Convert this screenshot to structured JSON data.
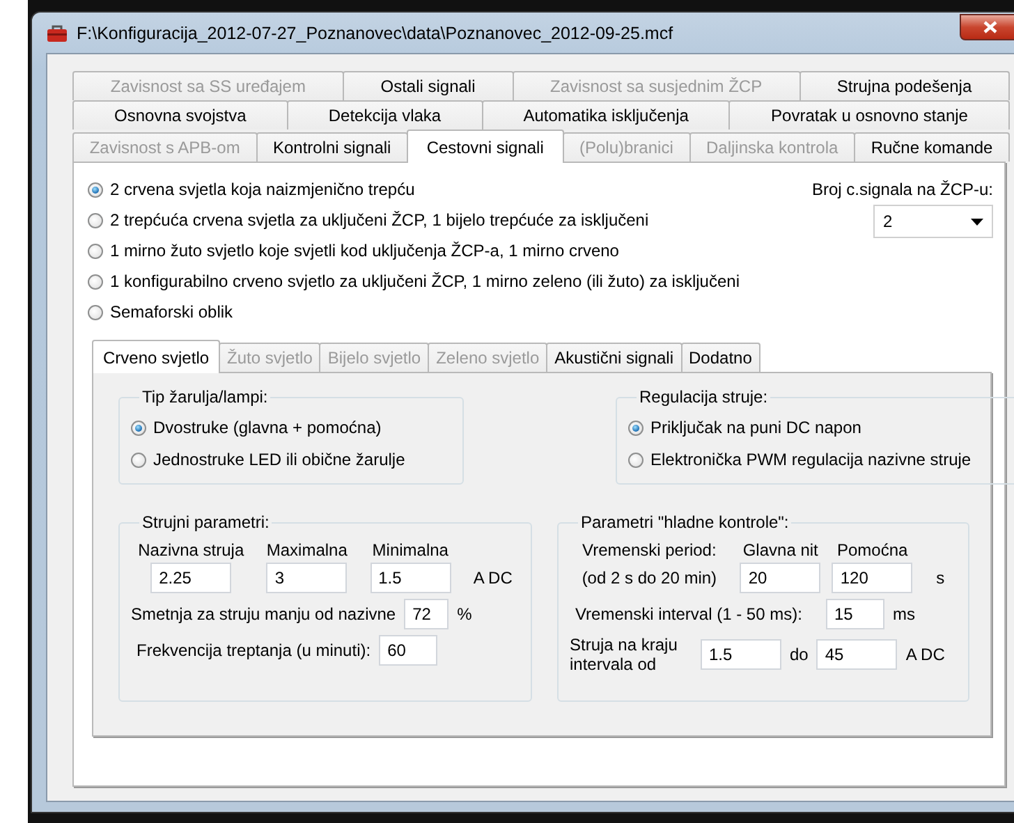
{
  "window": {
    "title": "F:\\Konfiguracija_2012-07-27_Poznanovec\\data\\Poznanovec_2012-09-25.mcf"
  },
  "tab_rows": [
    {
      "tabs": [
        {
          "label": "Zavisnost sa SS uređajem",
          "selected": false,
          "disabled": true
        },
        {
          "label": "Ostali signali",
          "selected": false,
          "disabled": false
        },
        {
          "label": "Zavisnost sa susjednim ŽCP",
          "selected": false,
          "disabled": true
        },
        {
          "label": "Strujna podešenja",
          "selected": false,
          "disabled": false
        }
      ]
    },
    {
      "tabs": [
        {
          "label": "Osnovna svojstva",
          "selected": false,
          "disabled": false
        },
        {
          "label": "Detekcija vlaka",
          "selected": false,
          "disabled": false
        },
        {
          "label": "Automatika isključenja",
          "selected": false,
          "disabled": false
        },
        {
          "label": "Povratak u osnovno stanje",
          "selected": false,
          "disabled": false
        }
      ]
    },
    {
      "tabs": [
        {
          "label": "Zavisnost s APB-om",
          "selected": false,
          "disabled": true
        },
        {
          "label": "Kontrolni signali",
          "selected": false,
          "disabled": false
        },
        {
          "label": "Cestovni signali",
          "selected": true,
          "disabled": false
        },
        {
          "label": "(Polu)branici",
          "selected": false,
          "disabled": true
        },
        {
          "label": "Daljinska kontrola",
          "selected": false,
          "disabled": true
        },
        {
          "label": "Ručne komande",
          "selected": false,
          "disabled": false
        }
      ]
    }
  ],
  "signal_modes": [
    {
      "label": "2 crvena svjetla koja naizmjenično trepću",
      "selected": true
    },
    {
      "label": "2 trepćuća crvena svjetla za uključeni ŽCP, 1 bijelo trepćuće za isključeni",
      "selected": false
    },
    {
      "label": "1 mirno žuto svjetlo koje svjetli kod uključenja ŽCP-a, 1 mirno crveno",
      "selected": false
    },
    {
      "label": "1 konfigurabilno crveno svjetlo za uključeni ŽCP, 1 mirno zeleno (ili žuto) za isključeni",
      "selected": false
    },
    {
      "label": "Semaforski oblik",
      "selected": false
    }
  ],
  "signal_count": {
    "label": "Broj c.signala na ŽCP-u:",
    "value": "2"
  },
  "light_tabs": [
    {
      "label": "Crveno svjetlo",
      "selected": true,
      "disabled": false
    },
    {
      "label": "Žuto svjetlo",
      "selected": false,
      "disabled": true
    },
    {
      "label": "Bijelo svjetlo",
      "selected": false,
      "disabled": true
    },
    {
      "label": "Zeleno svjetlo",
      "selected": false,
      "disabled": true
    },
    {
      "label": "Akustični signali",
      "selected": false,
      "disabled": false
    },
    {
      "label": "Dodatno",
      "selected": false,
      "disabled": false
    }
  ],
  "bulb_type": {
    "title": "Tip žarulja/lampi:",
    "options": [
      {
        "label": "Dvostruke (glavna + pomoćna)",
        "selected": true
      },
      {
        "label": "Jednostruke LED ili obične žarulje",
        "selected": false
      }
    ]
  },
  "current_regulation": {
    "title": "Regulacija struje:",
    "options": [
      {
        "label": "Priključak na puni DC napon",
        "selected": true
      },
      {
        "label": "Elektronička PWM regulacija nazivne struje",
        "selected": false
      }
    ]
  },
  "current_params": {
    "title": "Strujni parametri:",
    "columns": [
      {
        "label": "Nazivna struja",
        "value": "2.25"
      },
      {
        "label": "Maximalna",
        "value": "3"
      },
      {
        "label": "Minimalna",
        "value": "1.5"
      }
    ],
    "unit": "A DC",
    "interference": {
      "label": "Smetnja za struju manju od nazivne",
      "value": "72",
      "unit": "%"
    },
    "frequency": {
      "label": "Frekvencija treptanja (u minuti):",
      "value": "60"
    }
  },
  "cold_control": {
    "title": "Parametri \"hladne kontrole\":",
    "period_label": "Vremenski period:",
    "period_range": "(od 2 s do 20 min)",
    "columns": [
      {
        "label": "Glavna nit",
        "value": "20"
      },
      {
        "label": "Pomoćna",
        "value": "120"
      }
    ],
    "unit": "s",
    "interval": {
      "label": "Vremenski interval (1 - 50 ms):",
      "value": "15",
      "unit": "ms"
    },
    "end_current": {
      "label": "Struja na kraju intervala od",
      "from": "1.5",
      "separator": "do",
      "to": "45",
      "unit": "A DC"
    }
  }
}
